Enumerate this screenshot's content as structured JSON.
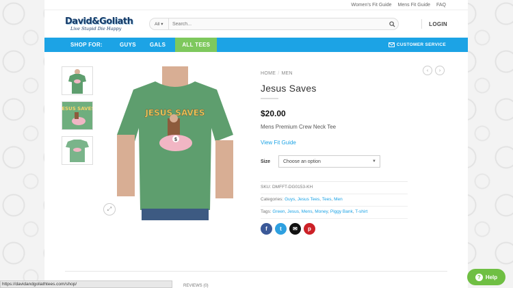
{
  "topbar": {
    "links": [
      "Women's Fit Guide",
      "Mens Fit Guide",
      "FAQ"
    ]
  },
  "header": {
    "logo_main": "David&Goliath",
    "logo_tagline": "Live Stupid Die Happy",
    "search_category": "All",
    "search_placeholder": "Search...",
    "login_label": "LOGIN"
  },
  "nav": {
    "shop_for": "SHOP FOR:",
    "items": [
      "GUYS",
      "GALS",
      "ALL TEES"
    ],
    "customer_service": "CUSTOMER SERVICE"
  },
  "product": {
    "breadcrumb": [
      "HOME",
      "MEN"
    ],
    "title": "Jesus Saves",
    "price": "$20.00",
    "description": "Mens Premium Crew Neck Tee",
    "fit_guide_link": "View Fit Guide",
    "size_label": "Size",
    "size_selected": "Choose an option",
    "shirt_text": "JESUS SAVES",
    "sku_label": "SKU:",
    "sku": "DMFFT-DG0153-KH",
    "categories_label": "Categories:",
    "categories": [
      "Guys",
      "Jesus Tees",
      "Tees",
      "Men"
    ],
    "tags_label": "Tags:",
    "tags": [
      "Green",
      "Jesus",
      "Mens",
      "Money",
      "Piggy Bank",
      "T-shirt"
    ]
  },
  "colors": {
    "nav_blue": "#1ca3e5",
    "all_tees_green": "#7ec85d",
    "shirt_green": "#5e9e6e",
    "help_green": "#6fbf43"
  },
  "bottom": {
    "reviews_tab": "REVIEWS (0)",
    "status_url": "https://davidandgoliathtees.com/shop/",
    "help_label": "Help"
  }
}
